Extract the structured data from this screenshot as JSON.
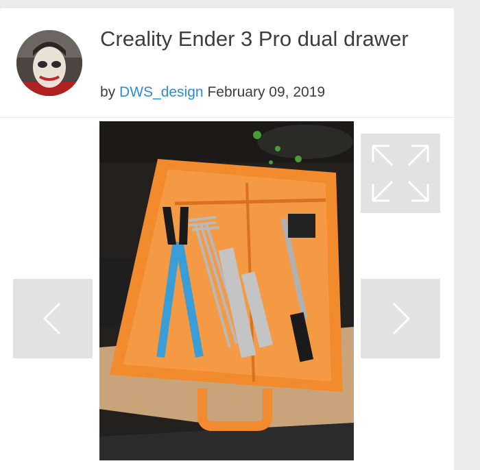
{
  "post": {
    "title": "Creality Ender 3 Pro dual drawer",
    "by_label": "by",
    "author": "DWS_design",
    "date": "February 09, 2019"
  },
  "icons": {
    "expand": "expand-icon",
    "prev": "chevron-left-icon",
    "next": "chevron-right-icon"
  },
  "colors": {
    "link": "#2e8ad8",
    "control_bg": "#e2e2e2",
    "tray_orange": "#f28a2e"
  }
}
